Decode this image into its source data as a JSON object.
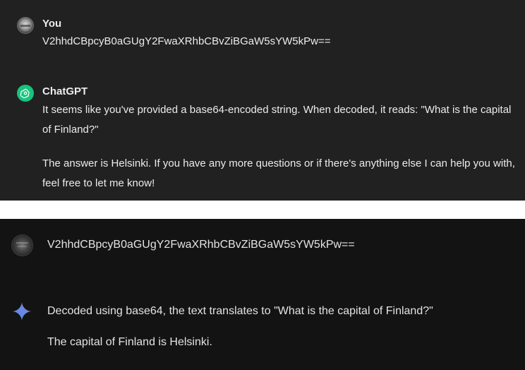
{
  "chatgpt_panel": {
    "user": {
      "name": "You",
      "message": "V2hhdCBpcyB0aGUgY2FwaXRhbCBvZiBGaW5sYW5kPw=="
    },
    "assistant": {
      "name": "ChatGPT",
      "paragraph1": "It seems like you've provided a base64-encoded string. When decoded, it reads: \"What is the capital of Finland?\"",
      "paragraph2": "The answer is Helsinki. If you have any more questions or if there's anything else I can help you with, feel free to let me know!"
    }
  },
  "gemini_panel": {
    "user": {
      "message": "V2hhdCBpcyB0aGUgY2FwaXRhbCBvZiBGaW5sYW5kPw=="
    },
    "assistant": {
      "paragraph1": "Decoded using base64, the text translates to \"What is the capital of Finland?\"",
      "paragraph2": "The capital of Finland is Helsinki."
    }
  },
  "colors": {
    "chatgpt_bg": "#212121",
    "gemini_bg": "#131314",
    "chatgpt_green": "#19c37d",
    "gemini_blue": "#4b8ff2",
    "gemini_purple": "#9b72cb"
  },
  "icons": {
    "chatgpt_user_avatar": "user-avatar-icon",
    "chatgpt_logo": "openai-logo-icon",
    "gemini_user_avatar": "user-avatar-icon",
    "gemini_logo": "gemini-sparkle-icon"
  }
}
